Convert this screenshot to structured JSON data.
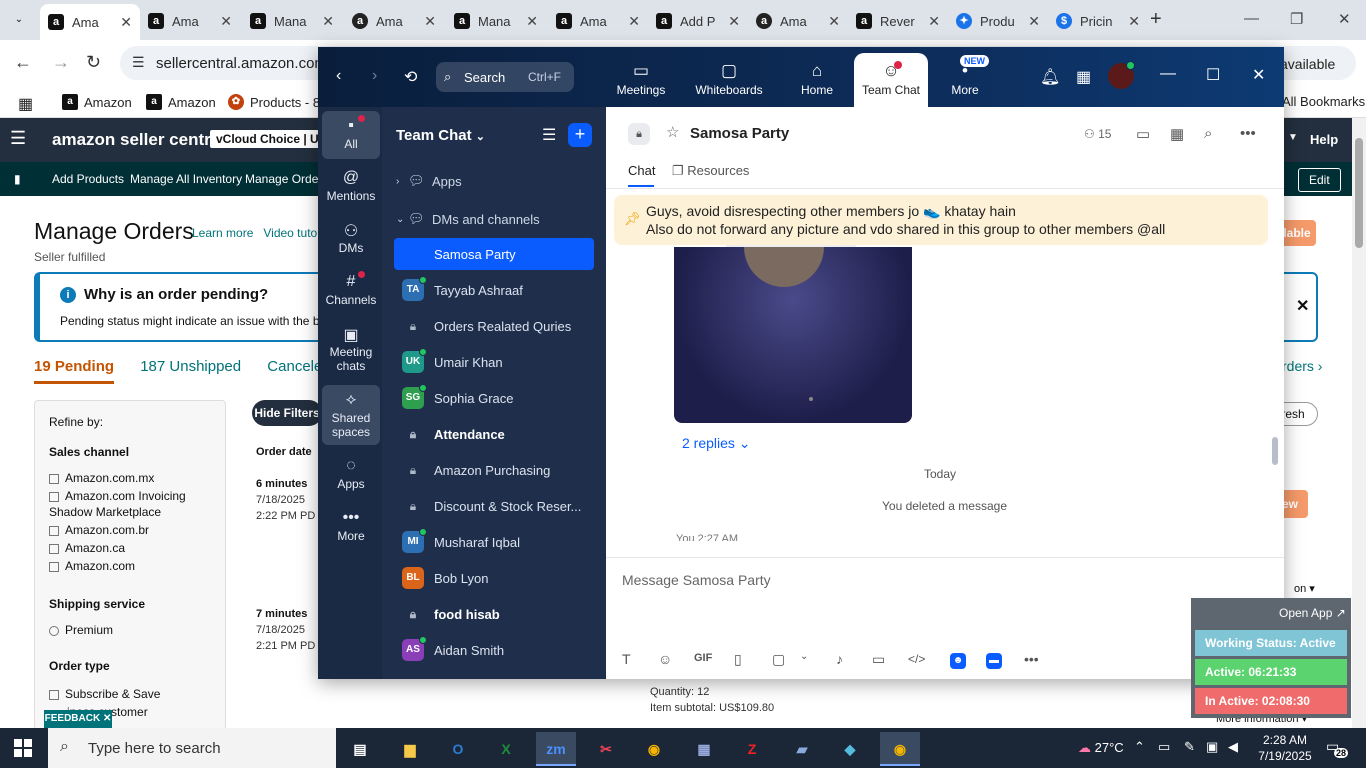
{
  "browser": {
    "tabs": [
      {
        "label": "Ama",
        "icon": "a",
        "active": true
      },
      {
        "label": "Ama",
        "icon": "a"
      },
      {
        "label": "Mana",
        "icon": "a"
      },
      {
        "label": "Ama",
        "icon": "a-smile"
      },
      {
        "label": "Mana",
        "icon": "a"
      },
      {
        "label": "Ama",
        "icon": "a"
      },
      {
        "label": "Add P",
        "icon": "a"
      },
      {
        "label": "Ama",
        "icon": "a-smile"
      },
      {
        "label": "Rever",
        "icon": "a"
      },
      {
        "label": "Produ",
        "icon": "zoom"
      },
      {
        "label": "Pricin",
        "icon": "dollar"
      }
    ],
    "url": "sellercentral.amazon.com/",
    "omni_right": "available",
    "bookmarks": [
      {
        "label": "Amazon"
      },
      {
        "label": "Amazon"
      },
      {
        "label": "Products - 88"
      }
    ],
    "all_bookmarks": "All Bookmarks"
  },
  "amazon": {
    "logo": "amazon seller central",
    "store": "vCloud Choice",
    "store_suffix": "Uni",
    "help": "Help",
    "nav": [
      "Add Products",
      "Manage All Inventory",
      "Manage Orders"
    ],
    "edit": "Edit",
    "title": "Manage Orders",
    "links": [
      "Learn more",
      "Video tutori"
    ],
    "subtitle": "Seller fulfilled",
    "pending_title": "Why is an order pending?",
    "pending_text": "Pending status might indicate an issue with the buy",
    "status_tabs": [
      "19 Pending",
      "187 Unshipped",
      "Canceled"
    ],
    "orders_link": "rders ›",
    "refresh": "fresh",
    "ilable": "ilable",
    "view": "ew",
    "refine": {
      "title": "Refine by:",
      "sales_channel": "Sales channel",
      "channels": [
        "Amazon.com.mx",
        "Amazon.com Invoicing",
        "Shadow Marketplace",
        "Amazon.com.br",
        "Amazon.ca",
        "Amazon.com"
      ],
      "shipping_service": "Shipping service",
      "premium": "Premium",
      "order_type": "Order type",
      "subscribe": "Subscribe & Save",
      "business": "iness customer"
    },
    "hide_filters": "Hide Filters",
    "order_date": "Order date",
    "orders": [
      {
        "ago": "6 minutes",
        "date": "7/18/2025",
        "time": "2:22 PM PD"
      },
      {
        "ago": "7 minutes",
        "date": "7/18/2025",
        "time": "2:21 PM PD"
      }
    ],
    "on": "on ▾",
    "quantity": "Quantity: 12",
    "subtotal": "Item subtotal: US$109.80",
    "more_info": "More information ▾",
    "feedback": "FEEDBACK ✕"
  },
  "zoom": {
    "search_label": "Search",
    "search_shortcut": "Ctrl+F",
    "nav": [
      {
        "label": "Meetings",
        "icon": "▭"
      },
      {
        "label": "Whiteboards",
        "icon": "▢"
      },
      {
        "label": "Home",
        "icon": "⌂"
      },
      {
        "label": "Team Chat",
        "icon": "☺",
        "active": true
      },
      {
        "label": "More",
        "icon": "•••"
      }
    ],
    "new_badge": "NEW",
    "rail": [
      {
        "label": "All",
        "icon": "▪"
      },
      {
        "label": "Mentions",
        "icon": "@"
      },
      {
        "label": "DMs",
        "icon": "⚇"
      },
      {
        "label": "Channels",
        "icon": "#"
      },
      {
        "label": "Meeting chats",
        "icon": "▣"
      },
      {
        "label": "Shared spaces",
        "icon": "⟡"
      },
      {
        "label": "Apps",
        "icon": "◌"
      },
      {
        "label": "More",
        "icon": "•••"
      }
    ],
    "list_title": "Team Chat",
    "sections": [
      "Apps",
      "DMs and channels"
    ],
    "items": [
      {
        "name": "Samosa Party",
        "type": "channel",
        "selected": true
      },
      {
        "name": "Tayyab Ashraaf",
        "type": "dm",
        "initials": "TA",
        "color": "#2d6fb3"
      },
      {
        "name": "Orders Realated Quries",
        "type": "private"
      },
      {
        "name": "Umair Khan",
        "type": "dm",
        "initials": "UK",
        "color": "#1f9a8a"
      },
      {
        "name": "Sophia Grace",
        "type": "dm",
        "initials": "SG",
        "color": "#2e9e4f"
      },
      {
        "name": "Attendance",
        "type": "private",
        "bold": true
      },
      {
        "name": "Amazon Purchasing",
        "type": "private"
      },
      {
        "name": "Discount & Stock Reser...",
        "type": "private"
      },
      {
        "name": "Musharaf Iqbal",
        "type": "dm",
        "initials": "MI",
        "color": "#2d6fb3"
      },
      {
        "name": "Bob Lyon",
        "type": "dm",
        "initials": "BL",
        "color": "#d9641a"
      },
      {
        "name": "food hisab",
        "type": "private",
        "bold": true
      },
      {
        "name": "Aidan Smith",
        "type": "dm",
        "initials": "AS",
        "color": "#8a3fb8"
      }
    ],
    "channel": {
      "name": "Samosa Party",
      "members": "15",
      "tabs": [
        "Chat",
        "Resources"
      ],
      "pinned_line1": "Guys, avoid disrespecting other members jo 👟 khatay hain",
      "pinned_line2": "Also do not forward any picture and vdo shared in this group to other members @all",
      "replies": "2 replies ⌄",
      "today": "Today",
      "deleted": "You deleted a message",
      "you_time": "You 2:27 AM",
      "placeholder": "Message Samosa Party"
    }
  },
  "work_status": {
    "open_app": "Open App ↗",
    "status": "Working Status: Active",
    "active": "Active: 06:21:33",
    "inactive": "In Active: 02:08:30"
  },
  "taskbar": {
    "search": "Type here to search",
    "temp": "27°C",
    "time": "2:28 AM",
    "date": "7/19/2025",
    "notifications": "28"
  }
}
